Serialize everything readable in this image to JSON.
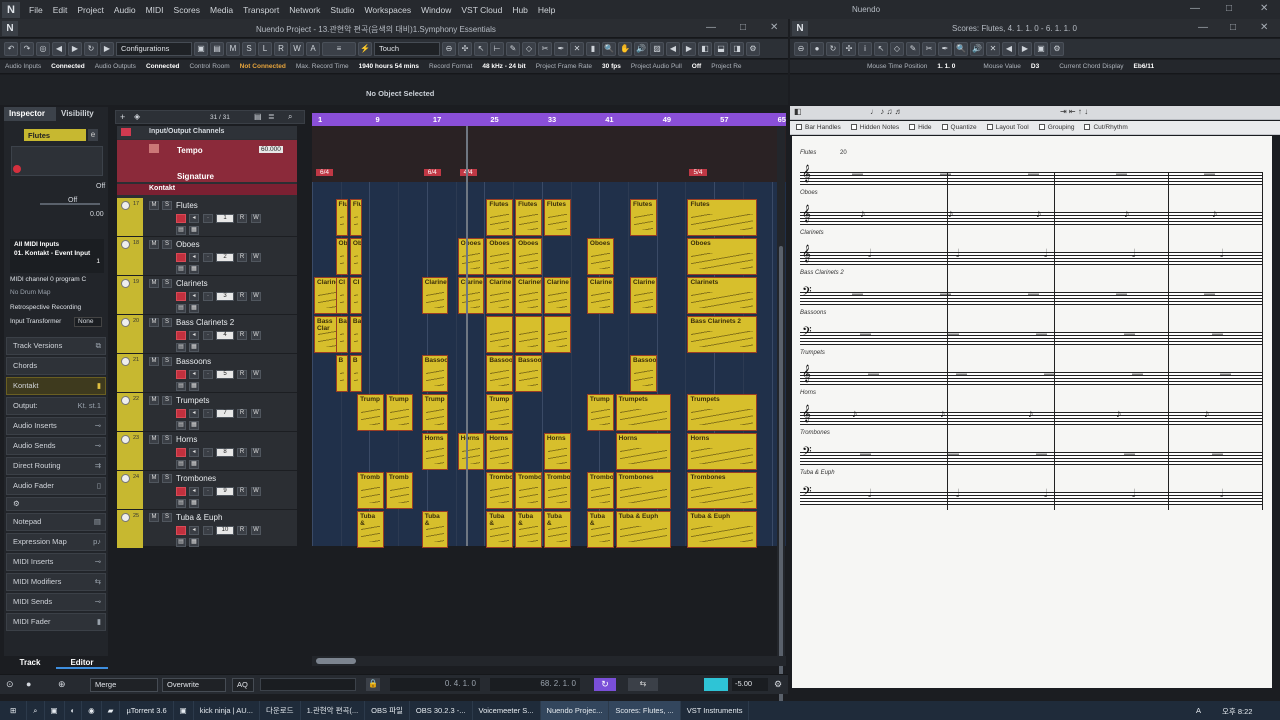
{
  "menu": {
    "items": [
      "File",
      "Edit",
      "Project",
      "Audio",
      "MIDI",
      "Scores",
      "Media",
      "Transport",
      "Network",
      "Studio",
      "Workspaces",
      "Window",
      "VST Cloud",
      "Hub",
      "Help"
    ],
    "app_title": "Nuendo"
  },
  "project_window": {
    "title": "Nuendo Project - 13.관현악 편곡(음색의 대비)1.Symphony Essentials",
    "touch": "Touch",
    "configurations": "Configurations"
  },
  "score_window": {
    "title": "Scores: Flutes, 4. 1. 1.  0 - 6. 1. 1.  0"
  },
  "infobar": {
    "audio_inputs": "Audio Inputs",
    "audio_inputs_val": "Connected",
    "audio_outputs": "Audio Outputs",
    "audio_outputs_val": "Connected",
    "control_room": "Control Room",
    "control_room_val": "Not Connected",
    "max_rec": "Max. Record Time",
    "max_rec_val": "1940 hours 54 mins",
    "rec_format": "Record Format",
    "rec_format_val": "48 kHz - 24 bit",
    "frame_rate": "Project Frame Rate",
    "frame_rate_val": "30 fps",
    "pull": "Project Audio Pull",
    "pull_val": "Off",
    "last": "Project Re"
  },
  "score_info": {
    "mouse_time": "Mouse Time Position",
    "mouse_time_val": "1.  1.  0",
    "mouse_value": "Mouse Value",
    "mouse_value_val": "D3",
    "chord_display": "Current Chord Display",
    "chord_val": "Eb6/11"
  },
  "no_object": "No Object Selected",
  "inspector": {
    "tabs": [
      "Inspector",
      "Visibility"
    ],
    "track": "Flutes",
    "off1": "Off",
    "off2": "Off",
    "vol": "0.00",
    "midi_in": "All MIDI Inputs",
    "midi_out": "01. Kontakt - Event Input",
    "channel": "1",
    "program": "MIDI channel 0 program C",
    "drum": "No Drum Map",
    "retro": "Retrospective Recording",
    "input_transformer": "Input Transformer",
    "it_val": "None",
    "sections": [
      "Track Versions",
      "Chords",
      "Kontakt",
      "Output:",
      "Audio Inserts",
      "Audio Sends",
      "Direct Routing",
      "Audio Fader",
      "Notepad",
      "Expression Map",
      "MIDI Inserts",
      "MIDI Modifiers",
      "MIDI Sends",
      "MIDI Fader"
    ],
    "output_val": "Kt. st.1",
    "bottom_tabs": [
      "Track",
      "Editor"
    ]
  },
  "tracklist": {
    "counter": "31 / 31",
    "io": "Input/Output Channels",
    "tempo": "Tempo",
    "tempo_val": "60.000",
    "signature": "Signature",
    "kontakt": "Kontakt",
    "tracks": [
      {
        "num": "17",
        "name": "Flutes",
        "ch": "1"
      },
      {
        "num": "18",
        "name": "Oboes",
        "ch": "2"
      },
      {
        "num": "19",
        "name": "Clarinets",
        "ch": "3"
      },
      {
        "num": "20",
        "name": "Bass Clarinets 2",
        "ch": "4"
      },
      {
        "num": "21",
        "name": "Bassoons",
        "ch": "5"
      },
      {
        "num": "22",
        "name": "Trumpets",
        "ch": "7"
      },
      {
        "num": "23",
        "name": "Horns",
        "ch": "8"
      },
      {
        "num": "24",
        "name": "Trombones",
        "ch": "9"
      },
      {
        "num": "25",
        "name": "Tuba & Euph",
        "ch": "10"
      }
    ]
  },
  "ruler": {
    "marks": [
      "1",
      "9",
      "17",
      "25",
      "33",
      "41",
      "49",
      "57",
      "65"
    ],
    "signatures": [
      "6/4",
      "6/4",
      "4/4",
      "5/4"
    ]
  },
  "parts": [
    {
      "row": 0,
      "label": "Flu",
      "bar": 3,
      "len": 2
    },
    {
      "row": 0,
      "label": "Flu",
      "bar": 5,
      "len": 2
    },
    {
      "row": 0,
      "label": "Flutes",
      "bar": 24,
      "len": 4
    },
    {
      "row": 0,
      "label": "Flutes",
      "bar": 28,
      "len": 4
    },
    {
      "row": 0,
      "label": "Flutes",
      "bar": 32,
      "len": 4
    },
    {
      "row": 0,
      "label": "Flutes",
      "bar": 44,
      "len": 4
    },
    {
      "row": 0,
      "label": "Flutes",
      "bar": 52,
      "len": 10
    },
    {
      "row": 1,
      "label": "Ob",
      "bar": 3,
      "len": 2
    },
    {
      "row": 1,
      "label": "Ob",
      "bar": 5,
      "len": 2
    },
    {
      "row": 1,
      "label": "Oboes",
      "bar": 20,
      "len": 4
    },
    {
      "row": 1,
      "label": "Oboes",
      "bar": 24,
      "len": 4
    },
    {
      "row": 1,
      "label": "Oboes",
      "bar": 28,
      "len": 4
    },
    {
      "row": 1,
      "label": "Oboes",
      "bar": 38,
      "len": 4
    },
    {
      "row": 1,
      "label": "Oboes",
      "bar": 52,
      "len": 10
    },
    {
      "row": 2,
      "label": "Clarinets",
      "bar": 0,
      "len": 4
    },
    {
      "row": 2,
      "label": "Cl",
      "bar": 3,
      "len": 2
    },
    {
      "row": 2,
      "label": "Cl",
      "bar": 5,
      "len": 2
    },
    {
      "row": 2,
      "label": "Clarinet",
      "bar": 15,
      "len": 4
    },
    {
      "row": 2,
      "label": "Clarine",
      "bar": 20,
      "len": 4
    },
    {
      "row": 2,
      "label": "Clarine",
      "bar": 24,
      "len": 4
    },
    {
      "row": 2,
      "label": "Clarinet",
      "bar": 28,
      "len": 4
    },
    {
      "row": 2,
      "label": "Clarine",
      "bar": 32,
      "len": 4
    },
    {
      "row": 2,
      "label": "Clarine",
      "bar": 38,
      "len": 4
    },
    {
      "row": 2,
      "label": "Clarine",
      "bar": 44,
      "len": 4
    },
    {
      "row": 2,
      "label": "Clarinets",
      "bar": 52,
      "len": 10
    },
    {
      "row": 3,
      "label": "Bass Clar",
      "bar": 0,
      "len": 4
    },
    {
      "row": 3,
      "label": "Ba",
      "bar": 3,
      "len": 2
    },
    {
      "row": 3,
      "label": "Ba",
      "bar": 5,
      "len": 2
    },
    {
      "row": 3,
      "label": "",
      "bar": 24,
      "len": 4
    },
    {
      "row": 3,
      "label": "",
      "bar": 28,
      "len": 4
    },
    {
      "row": 3,
      "label": "",
      "bar": 32,
      "len": 4
    },
    {
      "row": 3,
      "label": "Bass Clarinets 2",
      "bar": 52,
      "len": 10
    },
    {
      "row": 4,
      "label": "B",
      "bar": 3,
      "len": 2
    },
    {
      "row": 4,
      "label": "B",
      "bar": 5,
      "len": 2
    },
    {
      "row": 4,
      "label": "Bassoon",
      "bar": 15,
      "len": 4
    },
    {
      "row": 4,
      "label": "Bassoon",
      "bar": 24,
      "len": 4
    },
    {
      "row": 4,
      "label": "Bassoon",
      "bar": 28,
      "len": 4
    },
    {
      "row": 4,
      "label": "Bassoon",
      "bar": 44,
      "len": 4
    },
    {
      "row": 5,
      "label": "Trump",
      "bar": 6,
      "len": 4
    },
    {
      "row": 5,
      "label": "Trump",
      "bar": 10,
      "len": 4
    },
    {
      "row": 5,
      "label": "Trump",
      "bar": 15,
      "len": 4
    },
    {
      "row": 5,
      "label": "Trump",
      "bar": 24,
      "len": 4
    },
    {
      "row": 5,
      "label": "Trump",
      "bar": 38,
      "len": 4
    },
    {
      "row": 5,
      "label": "Trumpets",
      "bar": 42,
      "len": 8
    },
    {
      "row": 5,
      "label": "Trumpets",
      "bar": 52,
      "len": 10
    },
    {
      "row": 6,
      "label": "Horns",
      "bar": 15,
      "len": 4
    },
    {
      "row": 6,
      "label": "Horns",
      "bar": 20,
      "len": 4
    },
    {
      "row": 6,
      "label": "Horns",
      "bar": 24,
      "len": 4
    },
    {
      "row": 6,
      "label": "Horns",
      "bar": 32,
      "len": 4
    },
    {
      "row": 6,
      "label": "Horns",
      "bar": 42,
      "len": 8
    },
    {
      "row": 6,
      "label": "Horns",
      "bar": 52,
      "len": 10
    },
    {
      "row": 7,
      "label": "Tromb",
      "bar": 6,
      "len": 4
    },
    {
      "row": 7,
      "label": "Tromb",
      "bar": 10,
      "len": 4
    },
    {
      "row": 7,
      "label": "Trombo",
      "bar": 24,
      "len": 4
    },
    {
      "row": 7,
      "label": "Trombo",
      "bar": 28,
      "len": 4
    },
    {
      "row": 7,
      "label": "Trombo",
      "bar": 32,
      "len": 4
    },
    {
      "row": 7,
      "label": "Trombo",
      "bar": 38,
      "len": 4
    },
    {
      "row": 7,
      "label": "Trombones",
      "bar": 42,
      "len": 8
    },
    {
      "row": 7,
      "label": "Trombones",
      "bar": 52,
      "len": 10
    },
    {
      "row": 8,
      "label": "Tuba &",
      "bar": 6,
      "len": 4
    },
    {
      "row": 8,
      "label": "Tuba &",
      "bar": 15,
      "len": 4
    },
    {
      "row": 8,
      "label": "Tuba &",
      "bar": 24,
      "len": 4
    },
    {
      "row": 8,
      "label": "Tuba &",
      "bar": 28,
      "len": 4
    },
    {
      "row": 8,
      "label": "Tuba &",
      "bar": 32,
      "len": 4
    },
    {
      "row": 8,
      "label": "Tuba &",
      "bar": 38,
      "len": 4
    },
    {
      "row": 8,
      "label": "Tuba & Euph",
      "bar": 42,
      "len": 8
    },
    {
      "row": 8,
      "label": "Tuba & Euph",
      "bar": 52,
      "len": 10
    }
  ],
  "score": {
    "options": [
      "Bar Handles",
      "Hidden Notes",
      "Hide",
      "Quantize",
      "Layout Tool",
      "Grouping",
      "Cut/Rhythm"
    ],
    "staves": [
      "Flutes",
      "Oboes",
      "Clarinets",
      "Bass Clarinets 2",
      "Bassoons",
      "Trumpets",
      "Horns",
      "Trombones",
      "Tuba & Euph"
    ],
    "measure_num": "20"
  },
  "transport": {
    "merge": "Merge",
    "overwrite": "Overwrite",
    "aq": "AQ",
    "left_loc": "0. 4. 1.  0",
    "right_loc": "68. 2. 1.  0",
    "volume": "-5.00"
  },
  "taskbar": {
    "tasks": [
      "µTorrent 3.6",
      "",
      "kick ninja | AU...",
      "다운로드",
      "1.관현악 편곡(...",
      "OBS 파일",
      "OBS 30.2.3 -...",
      "Voicemeeter S...",
      "Nuendo Projec...",
      "Scores: Flutes, ...",
      "VST Instruments"
    ],
    "clock": "오후 8:22",
    "lang": "A"
  }
}
